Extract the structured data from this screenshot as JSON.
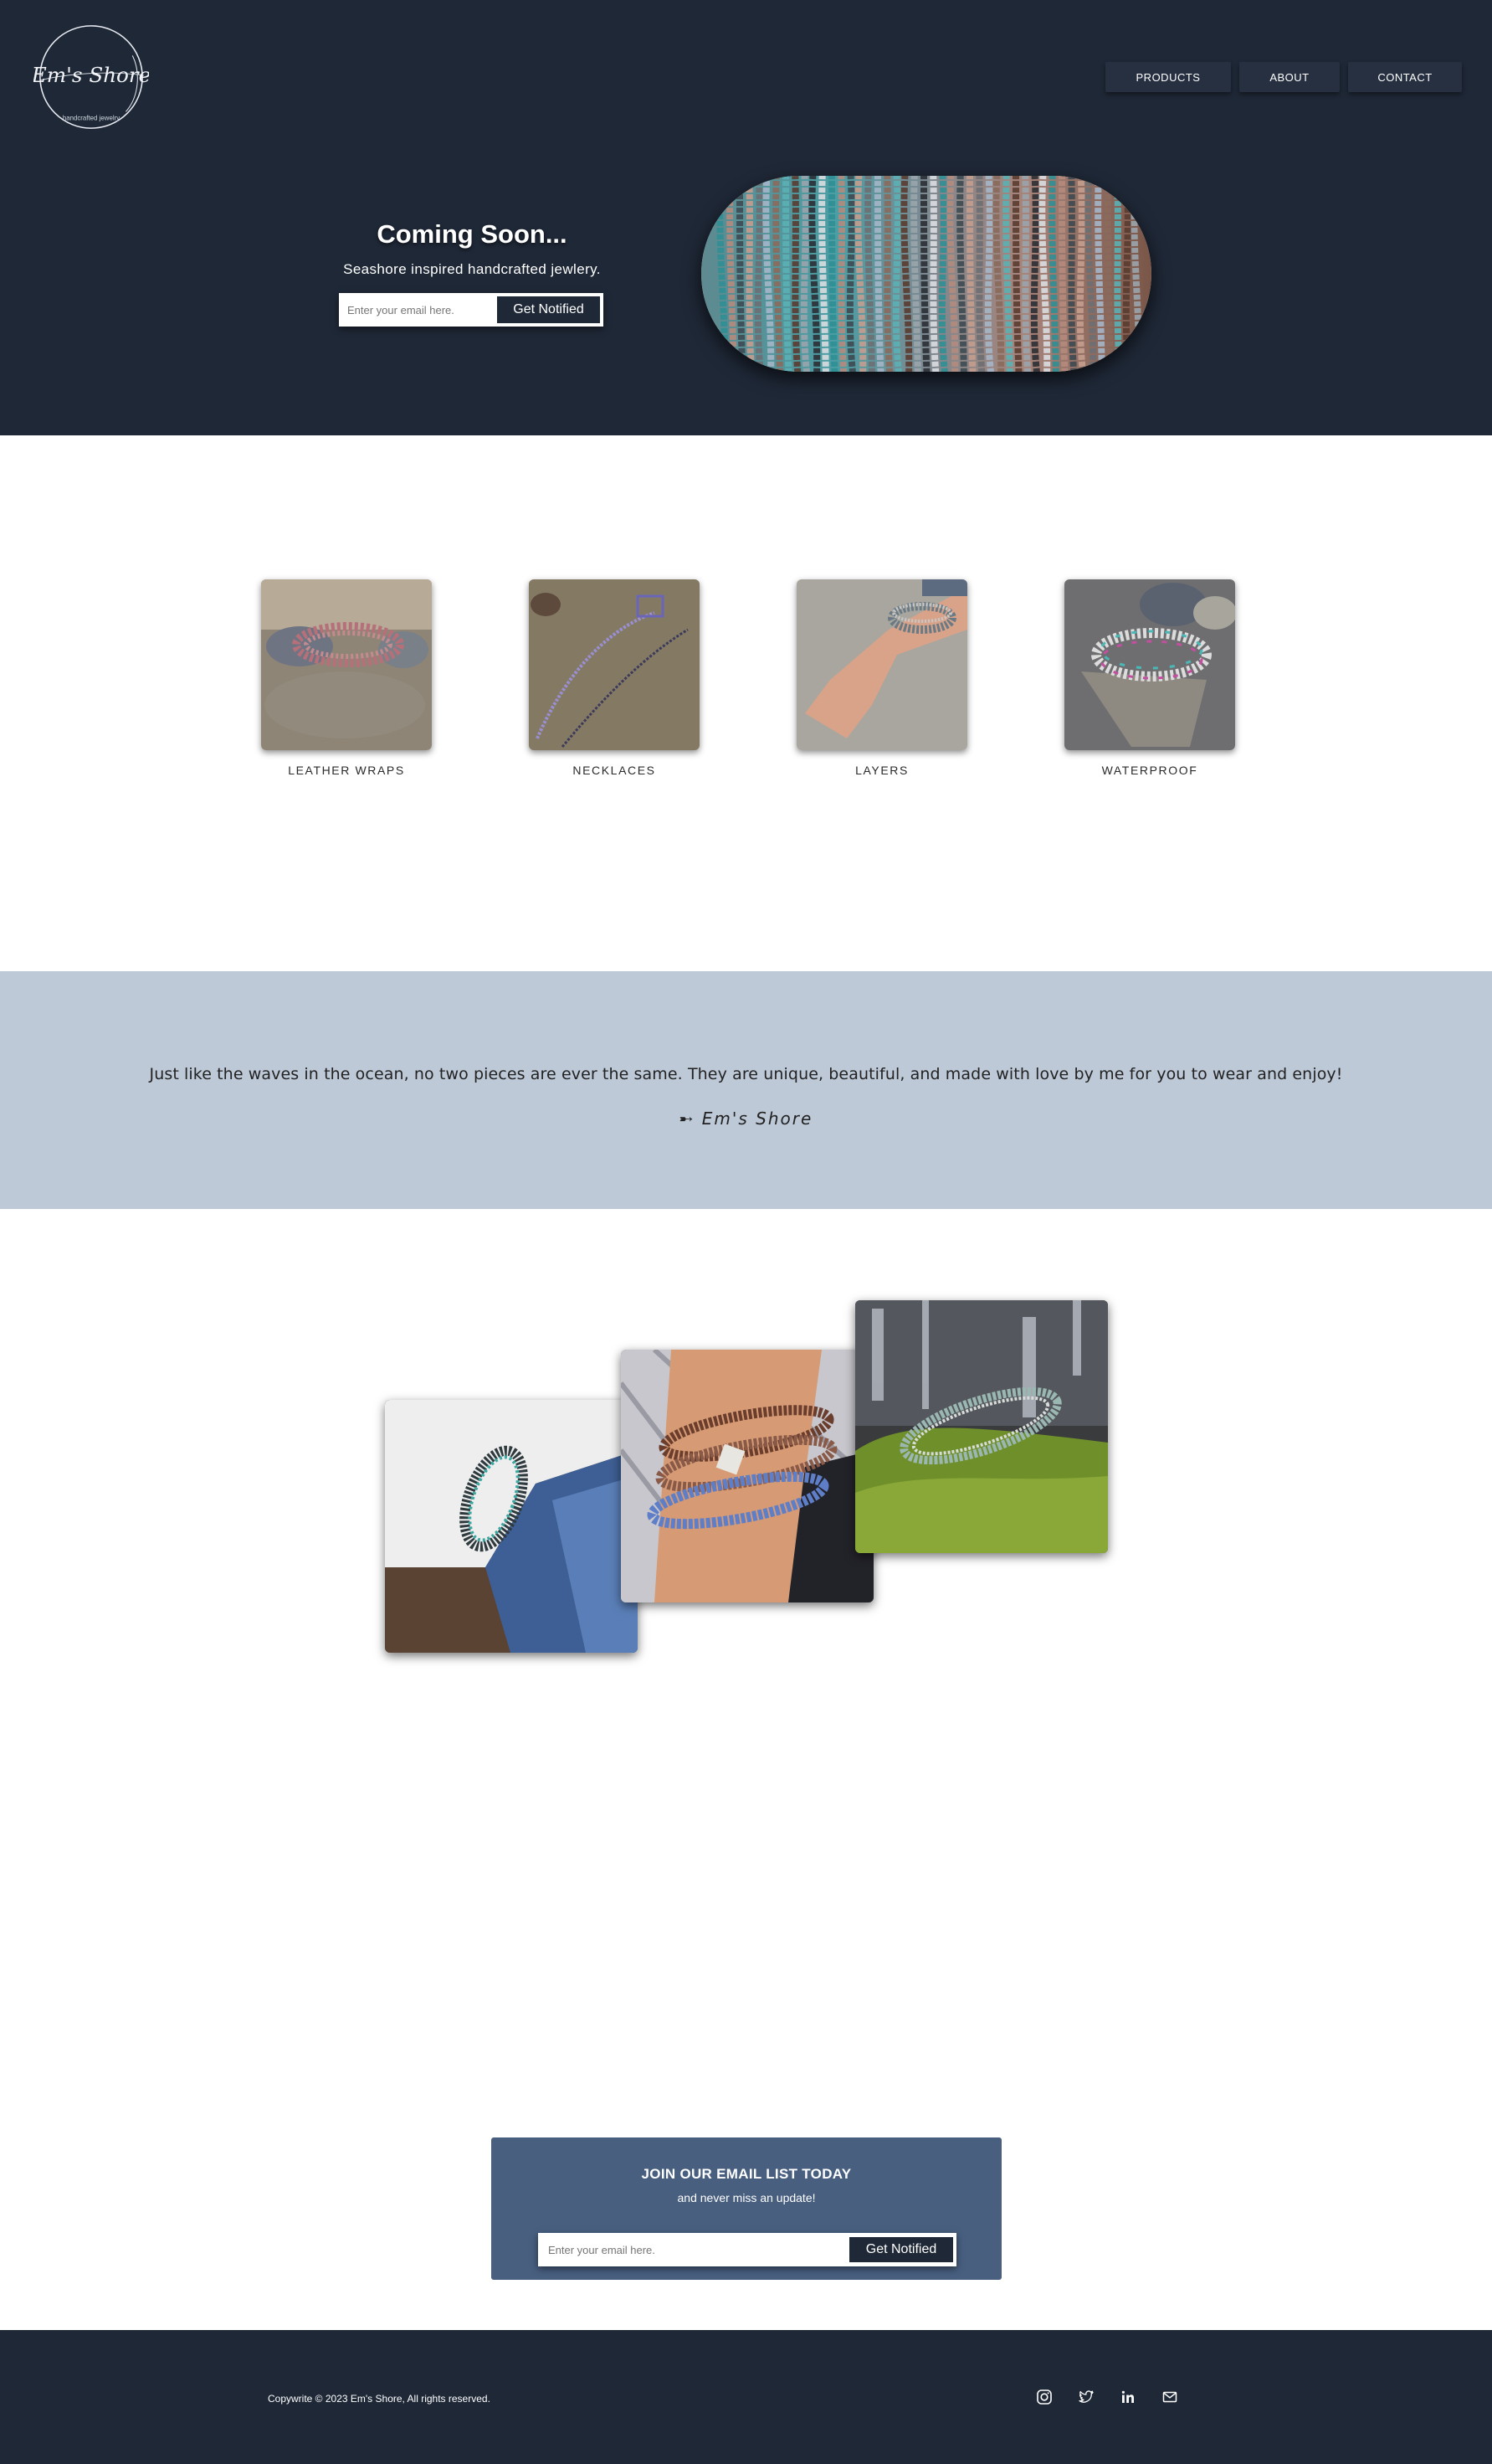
{
  "logo": {
    "text": "Em's Shore",
    "tagline": "handcrafted jewelry"
  },
  "nav": {
    "products": "PRODUCTS",
    "about": "ABOUT",
    "contact": "CONTACT"
  },
  "hero": {
    "title": "Coming Soon...",
    "subtitle": "Seashore inspired handcrafted jewlery.",
    "email_placeholder": "Enter your email here.",
    "button_label": "Get Notified"
  },
  "categories": [
    {
      "label": "LEATHER WRAPS"
    },
    {
      "label": "NECKLACES"
    },
    {
      "label": "LAYERS"
    },
    {
      "label": "WATERPROOF"
    }
  ],
  "quote": {
    "text": "Just like the waves in the ocean, no two pieces are ever the same. They are unique, beautiful, and made with love by me for you to wear and enjoy!",
    "signature": "➸ Em's Shore"
  },
  "email_list": {
    "title": "JOIN OUR EMAIL LIST TODAY",
    "subtitle": "and never miss an update!",
    "email_placeholder": "Enter your email here.",
    "button_label": "Get Notified"
  },
  "footer": {
    "copyright": "Copywrite © 2023 Em's Shore, All rights reserved.",
    "socials": [
      "instagram-icon",
      "twitter-icon",
      "linkedin-icon",
      "mail-icon"
    ]
  },
  "colors": {
    "navy": "#1f2837",
    "quote_band": "#bec9d8",
    "email_card": "#485f80"
  }
}
